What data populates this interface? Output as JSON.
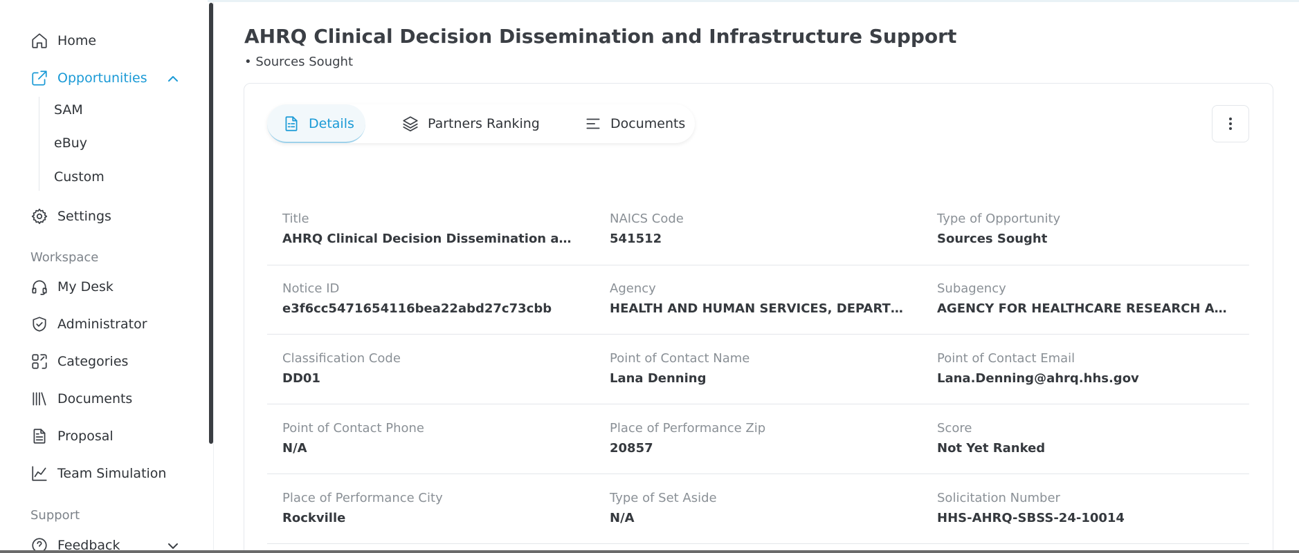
{
  "sidebar": {
    "items": {
      "home": "Home",
      "opportunities": "Opportunities",
      "settings": "Settings",
      "my_desk": "My Desk",
      "administrator": "Administrator",
      "categories": "Categories",
      "documents": "Documents",
      "proposal": "Proposal",
      "team_simulation": "Team Simulation",
      "feedback": "Feedback"
    },
    "sub_items": [
      "SAM",
      "eBuy",
      "Custom"
    ],
    "sections": {
      "workspace": "Workspace",
      "support": "Support"
    },
    "accent": "#1a9ad6"
  },
  "main": {
    "title": "AHRQ Clinical Decision Dissemination and Infrastructure Support",
    "subtitle": "• Sources Sought",
    "tabs": [
      "Details",
      "Partners Ranking",
      "Documents"
    ],
    "active_tab": "Details",
    "fields": [
      {
        "label": "Title",
        "value": "AHRQ Clinical Decision Dissemination and Inf..."
      },
      {
        "label": "NAICS Code",
        "value": "541512"
      },
      {
        "label": "Type of Opportunity",
        "value": "Sources Sought"
      },
      {
        "label": "Notice ID",
        "value": "e3f6cc5471654116bea22abd27c73cbb"
      },
      {
        "label": "Agency",
        "value": "HEALTH AND HUMAN SERVICES, DEPARTMEN..."
      },
      {
        "label": "Subagency",
        "value": "AGENCY FOR HEALTHCARE RESEARCH AND Q..."
      },
      {
        "label": "Classification Code",
        "value": "DD01"
      },
      {
        "label": "Point of Contact Name",
        "value": "Lana Denning"
      },
      {
        "label": "Point of Contact Email",
        "value": "Lana.Denning@ahrq.hhs.gov"
      },
      {
        "label": "Point of Contact Phone",
        "value": "N/A"
      },
      {
        "label": "Place of Performance Zip",
        "value": "20857"
      },
      {
        "label": "Score",
        "value": "Not Yet Ranked"
      },
      {
        "label": "Place of Performance City",
        "value": "Rockville"
      },
      {
        "label": "Type of Set Aside",
        "value": "N/A"
      },
      {
        "label": "Solicitation Number",
        "value": "HHS-AHRQ-SBSS-24-10014"
      }
    ]
  }
}
